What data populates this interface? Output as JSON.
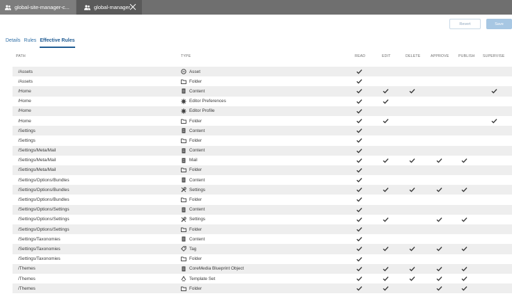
{
  "tabs": [
    {
      "label": "global-site-manager-c...",
      "icon": "users-icon",
      "active": false
    },
    {
      "label": "global-manager",
      "icon": "users-icon",
      "active": true
    }
  ],
  "actions": {
    "revert_label": "Revert",
    "save_label": "Save"
  },
  "subtabs": [
    {
      "label": "Details",
      "active": false
    },
    {
      "label": "Rules",
      "active": false
    },
    {
      "label": "Effective Rules",
      "active": true
    }
  ],
  "columns": [
    "PATH",
    "TYPE",
    "READ",
    "EDIT",
    "DELETE",
    "APPROVE",
    "PUBLISH",
    "SUPERVISE"
  ],
  "rows": [
    {
      "path": "/Assets",
      "type": "Asset",
      "icon": "asset-icon",
      "perms": [
        1,
        0,
        0,
        0,
        0,
        0
      ]
    },
    {
      "path": "/Assets",
      "type": "Folder",
      "icon": "folder-icon",
      "perms": [
        1,
        0,
        0,
        0,
        0,
        0
      ]
    },
    {
      "path": "/Home",
      "type": "Content",
      "icon": "content-icon",
      "perms": [
        1,
        1,
        1,
        0,
        0,
        1
      ]
    },
    {
      "path": "/Home",
      "type": "Editor Preferences",
      "icon": "gear-icon",
      "perms": [
        1,
        1,
        0,
        0,
        0,
        0
      ]
    },
    {
      "path": "/Home",
      "type": "Editor Profile",
      "icon": "gear-icon",
      "perms": [
        1,
        0,
        0,
        0,
        0,
        0
      ]
    },
    {
      "path": "/Home",
      "type": "Folder",
      "icon": "folder-icon",
      "perms": [
        1,
        1,
        0,
        0,
        0,
        1
      ]
    },
    {
      "path": "/Settings",
      "type": "Content",
      "icon": "content-icon",
      "perms": [
        1,
        0,
        0,
        0,
        0,
        0
      ]
    },
    {
      "path": "/Settings",
      "type": "Folder",
      "icon": "folder-icon",
      "perms": [
        1,
        0,
        0,
        0,
        0,
        0
      ]
    },
    {
      "path": "/Settings/Meta/Mail",
      "type": "Content",
      "icon": "content-icon",
      "perms": [
        1,
        0,
        0,
        0,
        0,
        0
      ]
    },
    {
      "path": "/Settings/Meta/Mail",
      "type": "Mail",
      "icon": "content-icon",
      "perms": [
        1,
        1,
        1,
        1,
        1,
        0
      ]
    },
    {
      "path": "/Settings/Meta/Mail",
      "type": "Folder",
      "icon": "folder-icon",
      "perms": [
        1,
        0,
        0,
        0,
        0,
        0
      ]
    },
    {
      "path": "/Settings/Options/Bundles",
      "type": "Content",
      "icon": "content-icon",
      "perms": [
        1,
        0,
        0,
        0,
        0,
        0
      ]
    },
    {
      "path": "/Settings/Options/Bundles",
      "type": "Settings",
      "icon": "tools-icon",
      "perms": [
        1,
        1,
        1,
        1,
        1,
        0
      ]
    },
    {
      "path": "/Settings/Options/Bundles",
      "type": "Folder",
      "icon": "folder-icon",
      "perms": [
        1,
        0,
        0,
        0,
        0,
        0
      ]
    },
    {
      "path": "/Settings/Options/Settings",
      "type": "Content",
      "icon": "content-icon",
      "perms": [
        1,
        0,
        0,
        0,
        0,
        0
      ]
    },
    {
      "path": "/Settings/Options/Settings",
      "type": "Settings",
      "icon": "tools-icon",
      "perms": [
        1,
        1,
        0,
        1,
        1,
        0
      ]
    },
    {
      "path": "/Settings/Options/Settings",
      "type": "Folder",
      "icon": "folder-icon",
      "perms": [
        1,
        0,
        0,
        0,
        0,
        0
      ]
    },
    {
      "path": "/Settings/Taxonomies",
      "type": "Content",
      "icon": "content-icon",
      "perms": [
        1,
        0,
        0,
        0,
        0,
        0
      ]
    },
    {
      "path": "/Settings/Taxonomies",
      "type": "Tag",
      "icon": "tag-icon",
      "perms": [
        1,
        1,
        1,
        1,
        1,
        0
      ]
    },
    {
      "path": "/Settings/Taxonomies",
      "type": "Folder",
      "icon": "folder-icon",
      "perms": [
        1,
        0,
        0,
        0,
        0,
        0
      ]
    },
    {
      "path": "/Themes",
      "type": "CoreMedia Blueprint Object",
      "icon": "content-icon",
      "perms": [
        1,
        1,
        1,
        1,
        1,
        0
      ]
    },
    {
      "path": "/Themes",
      "type": "Template Set",
      "icon": "template-icon",
      "perms": [
        1,
        1,
        1,
        1,
        1,
        0
      ]
    },
    {
      "path": "/Themes",
      "type": "Folder",
      "icon": "folder-icon",
      "perms": [
        1,
        1,
        0,
        1,
        1,
        0
      ]
    }
  ],
  "colors": {
    "tabbar": "#6f6f6f",
    "accent": "#1e5a92",
    "save_button": "#a7c7e3",
    "stripe": "#eeeeee"
  }
}
